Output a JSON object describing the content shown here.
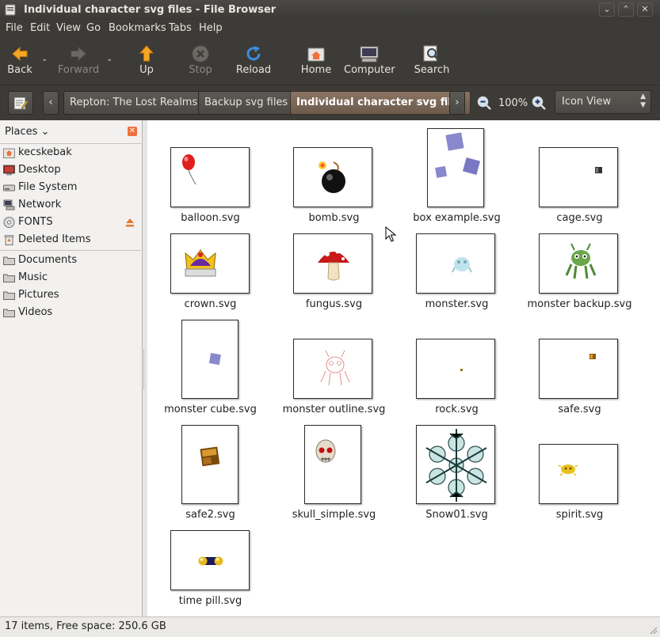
{
  "window": {
    "title": "Individual character svg files - File Browser"
  },
  "menu": [
    "File",
    "Edit",
    "View",
    "Go",
    "Bookmarks",
    "Tabs",
    "Help"
  ],
  "toolbar": {
    "back": "Back",
    "forward": "Forward",
    "up": "Up",
    "stop": "Stop",
    "reload": "Reload",
    "home": "Home",
    "computer": "Computer",
    "search": "Search"
  },
  "location": {
    "crumbs": [
      "Repton: The Lost Realms",
      "Backup svg files",
      "Individual character svg files"
    ],
    "zoom": "100%",
    "view_mode": "Icon View"
  },
  "sidebar": {
    "header": "Places",
    "items": [
      "kecskebak",
      "Desktop",
      "File System",
      "Network",
      "FONTS",
      "Deleted Items"
    ],
    "bookmarks": [
      "Documents",
      "Music",
      "Pictures",
      "Videos"
    ]
  },
  "files": [
    "balloon.svg",
    "bomb.svg",
    "box example.svg",
    "cage.svg",
    "crown.svg",
    "fungus.svg",
    "monster.svg",
    "monster backup.svg",
    "monster cube.svg",
    "monster outline.svg",
    "rock.svg",
    "safe.svg",
    "safe2.svg",
    "skull_simple.svg",
    "Snow01.svg",
    "spirit.svg",
    "time pill.svg"
  ],
  "status": {
    "text": "17 items, Free space: 250.6 GB"
  },
  "colors": {
    "accent_crumb": "#7c6757",
    "window_dark": "#3c3b37"
  }
}
